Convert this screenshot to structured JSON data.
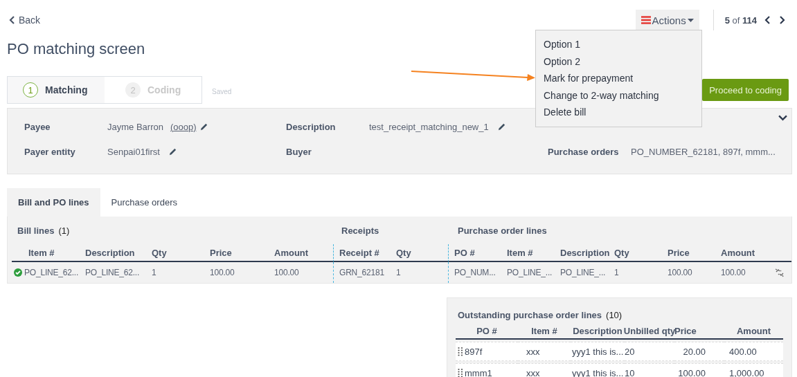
{
  "back": "Back",
  "actions": {
    "label": "Actions",
    "expanded": true,
    "menu": [
      "Option 1",
      "Option 2",
      "Mark for prepayment",
      "Change to 2-way matching",
      "Delete bill"
    ]
  },
  "pager": {
    "text": "**5** of **114**"
  },
  "title": "PO matching screen",
  "steps": [
    {
      "number": "1",
      "label": "Matching",
      "selected": true
    },
    {
      "number": "2",
      "label": "Coding",
      "selected": false
    }
  ],
  "save_status": "Saved",
  "proceed_button": "Proceed to coding",
  "details": [
    [
      {
        "label": "Payee",
        "value": "Jayme Barron",
        "link": "(ooop)",
        "editable": true
      },
      {
        "label": "Payer entity",
        "value": "Senpai01first",
        "editable": true
      }
    ],
    [
      {
        "label": "Description",
        "value": "test_receipt_matching_new_1",
        "editable": true
      },
      {
        "label": "Buyer",
        "editable": false
      }
    ],
    [
      {
        "label": "Purchase orders",
        "value": "PO_NUMBER_62181, 897f, mmm...",
        "editable": false
      }
    ]
  ],
  "tabs": [
    {
      "label": "Bill and PO lines",
      "selected": true
    },
    {
      "label": "Purchase orders",
      "selected": false
    }
  ],
  "matching": {
    "groups": [
      {
        "title": "Bill lines",
        "count": "(1)",
        "columns": [
          "Item #",
          "Description",
          "Qty",
          "Price",
          "Amount"
        ]
      },
      {
        "title": "Receipts",
        "columns": [
          "Receipt #",
          "Qty"
        ]
      },
      {
        "title": "Purchase order lines",
        "columns": [
          "PO #",
          "Item #",
          "Description",
          "Qty",
          "Price",
          "Amount"
        ]
      }
    ],
    "rows": [
      {
        "matched": true,
        "cells": [
          [
            "PO_LINE_62...",
            "PO_LINE_62...",
            "1",
            "100.00",
            "100.00"
          ],
          [
            "GRN_62181",
            "1"
          ],
          [
            "PO_NUM...",
            "PO_LINE_...",
            "PO_LINE_...",
            "1",
            "100.00",
            "100.00"
          ]
        ]
      }
    ]
  },
  "outstanding": {
    "title": "Outstanding purchase order lines",
    "count": "(10)",
    "columns": [
      "PO #",
      "Item #",
      "Description",
      "Unbilled qty",
      "Price",
      "Amount"
    ],
    "rows": [
      [
        "897f",
        "xxx",
        "yyy1 this is...",
        "20",
        "20.00",
        "400.00"
      ],
      [
        "mmm1",
        "xxx",
        "yyy1 this is...",
        "10",
        "100.00",
        "1,000.00"
      ]
    ]
  }
}
